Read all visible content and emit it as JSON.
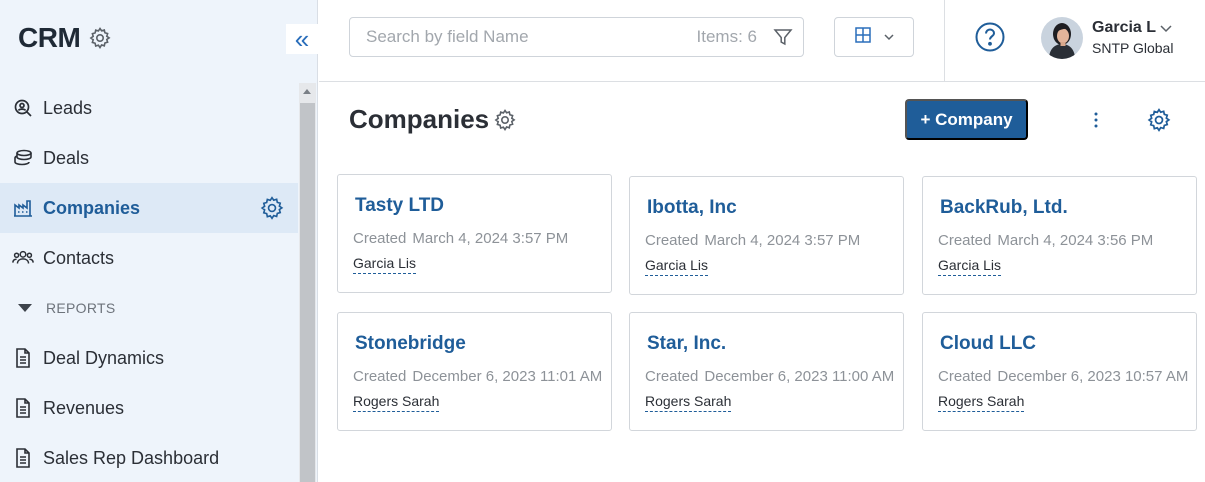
{
  "app": {
    "title": "CRM"
  },
  "sidebar": {
    "collapse_symbol": "«",
    "items": [
      {
        "label": "Leads",
        "icon": "leads-icon"
      },
      {
        "label": "Deals",
        "icon": "deals-icon"
      },
      {
        "label": "Companies",
        "icon": "companies-icon",
        "active": true
      },
      {
        "label": "Contacts",
        "icon": "contacts-icon"
      }
    ],
    "reports_label": "REPORTS",
    "reports": [
      {
        "label": "Deal Dynamics",
        "icon": "document-icon"
      },
      {
        "label": "Revenues",
        "icon": "document-icon"
      },
      {
        "label": "Sales Rep Dashboard",
        "icon": "document-icon"
      }
    ]
  },
  "topbar": {
    "search_placeholder": "Search by field Name",
    "items_count": "Items: 6",
    "user": {
      "name": "Garcia L",
      "org": "SNTP Global"
    }
  },
  "main": {
    "title": "Companies",
    "add_button": "+ Company"
  },
  "cards": [
    {
      "name": "Tasty LTD",
      "created_label": "Created",
      "created": "March 4, 2024 3:57 PM",
      "owner": "Garcia Lis"
    },
    {
      "name": "Ibotta, Inc",
      "created_label": "Created",
      "created": "March 4, 2024 3:57 PM",
      "owner": "Garcia Lis"
    },
    {
      "name": "BackRub, Ltd.",
      "created_label": "Created",
      "created": "March 4, 2024 3:56 PM",
      "owner": "Garcia Lis"
    },
    {
      "name": "Stonebridge",
      "created_label": "Created",
      "created": "December 6, 2023 11:01 AM",
      "owner": "Rogers Sarah"
    },
    {
      "name": "Star, Inc.",
      "created_label": "Created",
      "created": "December 6, 2023 11:00 AM",
      "owner": "Rogers Sarah"
    },
    {
      "name": "Cloud LLC",
      "created_label": "Created",
      "created": "December 6, 2023 10:57 AM",
      "owner": "Rogers Sarah"
    }
  ],
  "colors": {
    "accent": "#1f5d99",
    "sidebar_bg": "#eef4fb",
    "active_bg": "#dde9f6"
  }
}
